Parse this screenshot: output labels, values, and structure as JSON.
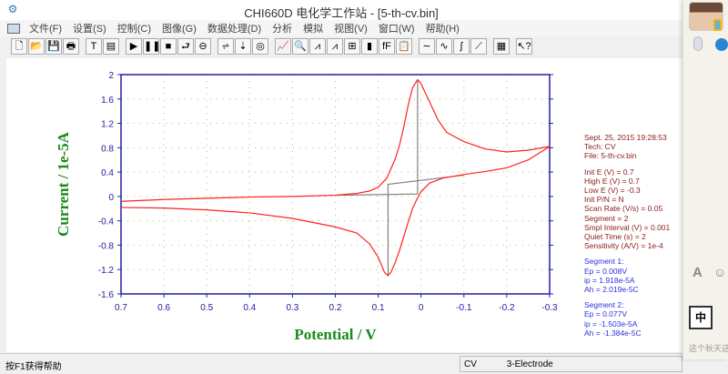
{
  "window": {
    "title": "CHI660D 电化学工作站 - [5-th-cv.bin]"
  },
  "menu": [
    "文件(F)",
    "设置(S)",
    "控制(C)",
    "图像(G)",
    "数据处理(D)",
    "分析",
    "模拟",
    "视图(V)",
    "窗口(W)",
    "帮助(H)"
  ],
  "toolbar": [
    {
      "icon": "new-file-icon",
      "glyph": "🗋"
    },
    {
      "icon": "open-folder-icon",
      "glyph": "📂"
    },
    {
      "icon": "save-icon",
      "glyph": "💾"
    },
    {
      "icon": "print-icon",
      "glyph": "🖶"
    },
    null,
    {
      "icon": "text-icon",
      "glyph": "T"
    },
    {
      "icon": "parameters-icon",
      "glyph": "▤"
    },
    null,
    {
      "icon": "run-icon",
      "glyph": "▶"
    },
    {
      "icon": "pause-icon",
      "glyph": "❚❚"
    },
    {
      "icon": "stop-icon",
      "glyph": "■"
    },
    {
      "icon": "reverse-icon",
      "glyph": "⮐"
    },
    {
      "icon": "ir-comp-icon",
      "glyph": "⊖"
    },
    null,
    {
      "icon": "technique-icon",
      "glyph": "⩫"
    },
    {
      "icon": "experiment-params-icon",
      "glyph": "⇣"
    },
    {
      "icon": "cell-control-icon",
      "glyph": "◎"
    },
    null,
    {
      "icon": "graph-icon",
      "glyph": "📈"
    },
    {
      "icon": "zoom-icon",
      "glyph": "🔍"
    },
    {
      "icon": "peak-icon",
      "glyph": "⩘"
    },
    {
      "icon": "peak-blue-icon",
      "glyph": "⩘"
    },
    {
      "icon": "overlay-icon",
      "glyph": "⊞"
    },
    {
      "icon": "color-icon",
      "glyph": "▮"
    },
    {
      "icon": "font-icon",
      "glyph": "fF"
    },
    {
      "icon": "clipboard-icon",
      "glyph": "📋"
    },
    null,
    {
      "icon": "smooth-icon",
      "glyph": "∼"
    },
    {
      "icon": "derivative-icon",
      "glyph": "∿"
    },
    {
      "icon": "integral-icon",
      "glyph": "∫"
    },
    {
      "icon": "baseline-icon",
      "glyph": "⟋"
    },
    null,
    {
      "icon": "table-icon",
      "glyph": "▦"
    },
    null,
    {
      "icon": "context-help-icon",
      "glyph": "↖?"
    }
  ],
  "info": {
    "date": "Sept. 25, 2015    19:28:53",
    "tech": "Tech: CV",
    "file": "File: 5-th-cv.bin",
    "params": [
      "Init E (V) = 0.7",
      "High E (V) = 0.7",
      "Low E (V) = -0.3",
      "Init P/N = N",
      "Scan Rate (V/s) = 0.05",
      "Segment = 2",
      "Smpl Interval (V) = 0.001",
      "Quiet Time (s) = 2",
      "Sensitivity (A/V) = 1e-4"
    ],
    "segment1": [
      "Segment 1:",
      "Ep = 0.008V",
      "ip = 1.918e-5A",
      "Ah = 2.019e-5C"
    ],
    "segment2": [
      "Segment 2:",
      "Ep = 0.077V",
      "ip = -1.503e-5A",
      "Ah = -1.384e-5C"
    ]
  },
  "status": {
    "help": "按F1获得帮助",
    "tech": "CV",
    "electrode": "3-Electrode"
  },
  "chat": {
    "ime": "中",
    "snippet": "这个秋天这"
  },
  "chart_data": {
    "type": "line",
    "xlabel": "Potential / V",
    "ylabel": "Current / 1e-5A",
    "xlim": [
      0.7,
      -0.3
    ],
    "ylim": [
      -1.6,
      2.0
    ],
    "x_reversed": true,
    "xticks": [
      0.7,
      0.6,
      0.5,
      0.4,
      0.3,
      0.2,
      0.1,
      0,
      -0.1,
      -0.2,
      -0.3
    ],
    "yticks": [
      2.0,
      1.6,
      1.2,
      0.8,
      0.4,
      0,
      -0.4,
      -0.8,
      -1.2,
      -1.6
    ],
    "grid": true,
    "colors": {
      "curve": "#ff2020",
      "baseline": "#808080",
      "axis": "#2020a0",
      "label": "#1a8a1a"
    },
    "series": [
      {
        "x": [
          0.7,
          0.6,
          0.5,
          0.4,
          0.3,
          0.2,
          0.15,
          0.12,
          0.1,
          0.08,
          0.06,
          0.05,
          0.04,
          0.03,
          0.02,
          0.008,
          0.0,
          -0.01,
          -0.02,
          -0.04,
          -0.06,
          -0.1,
          -0.15,
          -0.2,
          -0.25,
          -0.3
        ],
        "y": [
          -0.08,
          -0.05,
          -0.03,
          -0.01,
          0.0,
          0.02,
          0.05,
          0.09,
          0.15,
          0.3,
          0.62,
          0.85,
          1.15,
          1.5,
          1.78,
          1.918,
          1.85,
          1.7,
          1.55,
          1.25,
          1.05,
          0.9,
          0.78,
          0.73,
          0.76,
          0.82
        ]
      },
      {
        "x": [
          -0.3,
          -0.25,
          -0.2,
          -0.15,
          -0.1,
          -0.05,
          -0.02,
          0.0,
          0.01,
          0.02,
          0.03,
          0.04,
          0.05,
          0.06,
          0.07,
          0.077,
          0.085,
          0.1,
          0.12,
          0.15,
          0.2,
          0.3,
          0.4,
          0.5,
          0.6,
          0.7
        ],
        "y": [
          0.82,
          0.6,
          0.47,
          0.41,
          0.36,
          0.3,
          0.22,
          0.08,
          -0.05,
          -0.2,
          -0.42,
          -0.65,
          -0.88,
          -1.08,
          -1.24,
          -1.3,
          -1.25,
          -1.0,
          -0.78,
          -0.6,
          -0.5,
          -0.36,
          -0.27,
          -0.22,
          -0.19,
          -0.18
        ]
      }
    ],
    "baselines": [
      {
        "x": [
          0.2,
          0.008,
          0.008
        ],
        "y": [
          0.02,
          0.04,
          1.918
        ]
      },
      {
        "x": [
          -0.1,
          0.077,
          0.077
        ],
        "y": [
          0.35,
          0.2,
          -1.3
        ]
      }
    ]
  }
}
